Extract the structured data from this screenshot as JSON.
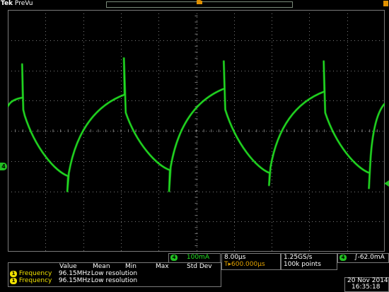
{
  "header": {
    "brand": "Tek",
    "status": "PreVu"
  },
  "channel4": {
    "badge": "4",
    "scale": "100mA"
  },
  "timebase": {
    "scale": "8.00µs",
    "trigger_position": "600.000µs",
    "trigger_position_prefix": "T▸"
  },
  "acquisition": {
    "sample_rate": "1.25GS/s",
    "record_length": "100k points"
  },
  "trigger": {
    "badge": "4",
    "slope": "∫",
    "level": "-62.0mA"
  },
  "measurements": {
    "headers": [
      "Value",
      "Mean",
      "Min",
      "Max",
      "Std Dev"
    ],
    "rows": [
      {
        "badge": "1",
        "name": "Frequency",
        "value": "96.15MHz",
        "mean": "Low resolution"
      },
      {
        "badge": "1",
        "name": "Frequency",
        "value": "96.15MHz",
        "mean": "Low resolution"
      }
    ]
  },
  "datetime": {
    "date": "20 Nov 2014",
    "time": "16:35:18"
  },
  "ground_marker": "4",
  "colors": {
    "trace": "#22e022",
    "grid": "#7a7a7a",
    "accent": "#e09000",
    "meas_badge": "#f0e000"
  },
  "chart_data": {
    "type": "line",
    "title": "",
    "xlabel": "",
    "ylabel": "",
    "grid": true,
    "divisions": {
      "x": 10,
      "y": 8
    },
    "x_unit": "div",
    "y_unit": "div",
    "xlim": [
      0,
      10
    ],
    "ylim": [
      -4,
      4
    ],
    "series": [
      {
        "x": [
          0.0,
          0.4,
          0.38,
          0.41,
          0.45,
          1.6,
          1.58,
          1.62,
          3.1,
          3.08,
          3.13,
          4.3,
          4.28,
          4.32,
          5.75,
          5.73,
          5.77,
          6.95,
          6.93,
          6.97,
          8.4,
          8.38,
          8.42,
          9.6,
          9.58,
          9.62,
          10.0
        ],
        "y": [
          0.8,
          1.1,
          2.2,
          0.7,
          0.5,
          -1.5,
          -2.0,
          -1.4,
          1.2,
          2.4,
          0.6,
          -1.3,
          -2.0,
          -1.2,
          1.4,
          2.3,
          0.7,
          -1.4,
          -1.8,
          -1.2,
          1.3,
          2.3,
          0.6,
          -1.4,
          -1.9,
          -1.0,
          0.9
        ]
      }
    ]
  }
}
